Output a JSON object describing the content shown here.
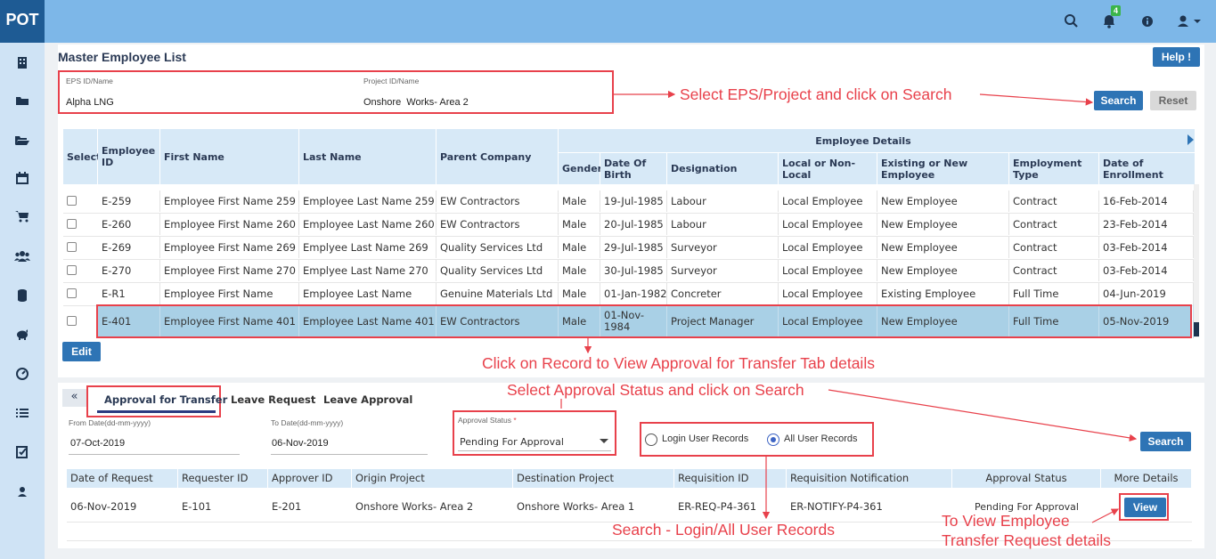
{
  "app": {
    "logo": "POT",
    "notification_count": "4"
  },
  "page": {
    "title": "Master Employee List",
    "help_label": "Help !"
  },
  "filters": {
    "eps_label": "EPS ID/Name",
    "eps_value": "Alpha LNG",
    "project_label": "Project ID/Name",
    "project_value": "Onshore  Works- Area 2",
    "search_label": "Search",
    "reset_label": "Reset"
  },
  "employee_table": {
    "headers": {
      "select": "Select",
      "employee_id": "Employee ID",
      "first_name": "First Name",
      "last_name": "Last Name",
      "parent_company": "Parent Company",
      "group": "Employee Details",
      "gender": "Gender",
      "dob": "Date Of Birth",
      "designation": "Designation",
      "local": "Local or Non-Local",
      "existing": "Existing or New Employee",
      "employment_type": "Employment Type",
      "enrollment": "Date of Enrollment"
    },
    "rows": [
      [
        "E-259",
        "Employee First Name 259",
        "Employee Last Name 259",
        "EW Contractors",
        "Male",
        "19-Jul-1985",
        "Labour",
        "Local Employee",
        "New Employee",
        "Contract",
        "16-Feb-2014"
      ],
      [
        "E-260",
        "Employee First Name 260",
        "Employee Last Name 260",
        "EW Contractors",
        "Male",
        "20-Jul-1985",
        "Labour",
        "Local Employee",
        "New Employee",
        "Contract",
        "23-Feb-2014"
      ],
      [
        "E-269",
        "Employee First Name 269",
        "Emplyee Last Name 269",
        "Quality Services Ltd",
        "Male",
        "29-Jul-1985",
        "Surveyor",
        "Local Employee",
        "New Employee",
        "Contract",
        "03-Feb-2014"
      ],
      [
        "E-270",
        "Employee First Name 270",
        "Emplyee Last Name 270",
        "Quality Services Ltd",
        "Male",
        "30-Jul-1985",
        "Surveyor",
        "Local Employee",
        "New Employee",
        "Contract",
        "03-Feb-2014"
      ],
      [
        "E-R1",
        "Employee First Name",
        "Employee Last Name",
        "Genuine Materials Ltd",
        "Male",
        "01-Jan-1982",
        "Concreter",
        "Local Employee",
        "Existing Employee",
        "Full Time",
        "04-Jun-2019"
      ],
      [
        "E-401",
        "Employee First Name 401",
        "Employee Last Name 401",
        "EW Contractors",
        "Male",
        "01-Nov-1984",
        "Project Manager",
        "Local Employee",
        "New Employee",
        "Full Time",
        "05-Nov-2019"
      ]
    ],
    "edit_label": "Edit"
  },
  "tabs": {
    "collapse": "«",
    "items": [
      "Approval for Transfer",
      "Leave Request",
      "Leave Approval"
    ]
  },
  "transfer_filters": {
    "from_label": "From Date(dd-mm-yyyy)",
    "from_value": "07-Oct-2019",
    "to_label": "To Date(dd-mm-yyyy)",
    "to_value": "06-Nov-2019",
    "status_label": "Approval Status",
    "status_required": "*",
    "status_value": "Pending For Approval",
    "radio_login": "Login User Records",
    "radio_all": "All User Records",
    "search_label": "Search"
  },
  "transfer_table": {
    "headers": [
      "Date of Request",
      "Requester ID",
      "Approver ID",
      "Origin Project",
      "Destination Project",
      "Requisition ID",
      "Requisition Notification",
      "Approval Status",
      "More Details"
    ],
    "rows": [
      [
        "06-Nov-2019",
        "E-101",
        "E-201",
        "Onshore Works- Area 2",
        "Onshore Works- Area 1",
        "ER-REQ-P4-361",
        "ER-NOTIFY-P4-361",
        "Pending For Approval",
        "View"
      ]
    ]
  },
  "annotations": {
    "a1": "Select EPS/Project and click on Search",
    "a2": "Click on Record to View Approval for Transfer Tab details",
    "a3": "Select Approval Status and click on Search",
    "a4": "Search - Login/All User Records",
    "a5_line1": "To View Employee",
    "a5_line2": "Transfer Request details"
  },
  "colors": {
    "accent": "#2e74b5",
    "header_bg": "#d7e9f7",
    "annotation": "#e8414b",
    "selected_row": "#a9d0e6"
  }
}
